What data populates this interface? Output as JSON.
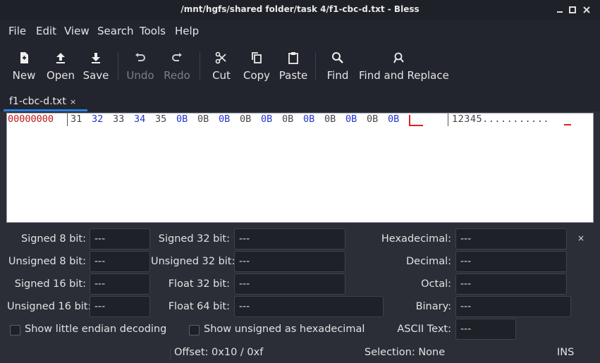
{
  "window": {
    "title": "/mnt/hgfs/shared folder/task 4/f1-cbc-d.txt - Bless"
  },
  "menu": [
    "File",
    "Edit",
    "View",
    "Search",
    "Tools",
    "Help"
  ],
  "toolbar": {
    "new": "New",
    "open": "Open",
    "save": "Save",
    "undo": "Undo",
    "redo": "Redo",
    "cut": "Cut",
    "copy": "Copy",
    "paste": "Paste",
    "find": "Find",
    "find_replace": "Find and Replace"
  },
  "tab": {
    "label": "f1-cbc-d.txt",
    "close": "×"
  },
  "hex": {
    "offset": "00000000",
    "bytes": [
      "31",
      "32",
      "33",
      "34",
      "35",
      "0B",
      "0B",
      "0B",
      "0B",
      "0B",
      "0B",
      "0B",
      "0B",
      "0B",
      "0B",
      "0B"
    ],
    "ascii": "12345..........."
  },
  "inspector": {
    "signed8_label": "Signed 8 bit:",
    "signed8_value": "---",
    "unsigned8_label": "Unsigned 8 bit:",
    "unsigned8_value": "---",
    "signed16_label": "Signed 16 bit:",
    "signed16_value": "---",
    "unsigned16_label": "Unsigned 16 bit:",
    "unsigned16_value": "---",
    "signed32_label": "Signed 32 bit:",
    "signed32_value": "---",
    "unsigned32_label": "Unsigned 32 bit:",
    "unsigned32_value": "---",
    "float32_label": "Float 32 bit:",
    "float32_value": "---",
    "float64_label": "Float 64 bit:",
    "float64_value": "---",
    "hex_label": "Hexadecimal:",
    "hex_value": "---",
    "dec_label": "Decimal:",
    "dec_value": "---",
    "oct_label": "Octal:",
    "oct_value": "---",
    "bin_label": "Binary:",
    "bin_value": "---",
    "ascii_label": "ASCII Text:",
    "ascii_value": "---",
    "little_endian_label": "Show little endian decoding",
    "unsigned_hex_label": "Show unsigned as hexadecimal",
    "close": "×"
  },
  "status": {
    "offset": "Offset: 0x10 / 0xf",
    "selection": "Selection: None",
    "mode": "INS"
  },
  "colors": {
    "accent": "#2a7fe0",
    "offset": "#c0181b",
    "byte_alt": "#2233cc",
    "cursor": "#dd2222"
  }
}
